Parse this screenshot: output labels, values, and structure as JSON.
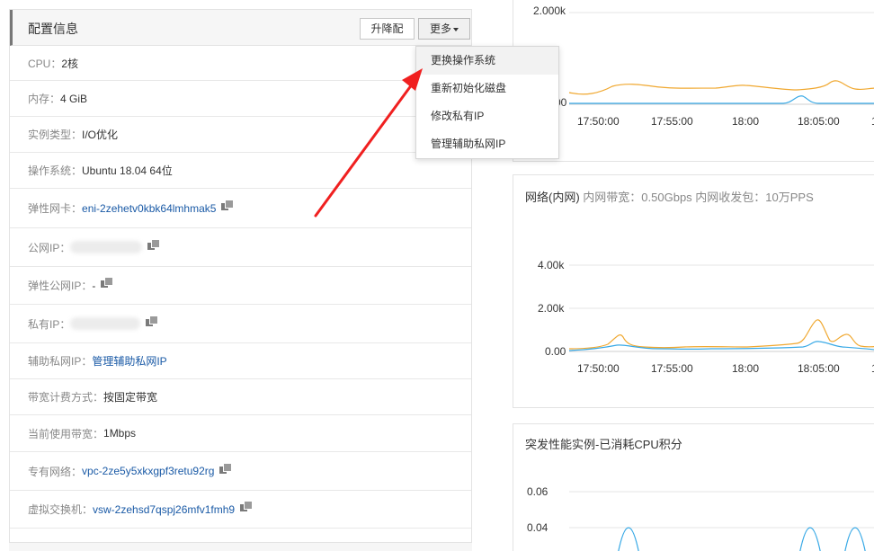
{
  "config": {
    "title": "配置信息",
    "upgrade_label": "升降配",
    "more_label": "更多",
    "rows": {
      "cpu_label": "CPU：",
      "cpu_value": "2核",
      "mem_label": "内存：",
      "mem_value": "4 GiB",
      "instance_type_label": "实例类型：",
      "instance_type_value": "I/O优化",
      "os_label": "操作系统：",
      "os_value": "Ubuntu 18.04 64位",
      "eni_label": "弹性网卡：",
      "eni_value": "eni-2zehetv0kbk64lmhmak5",
      "public_ip_label": "公网IP：",
      "eip_label": "弹性公网IP：",
      "eip_value": "-",
      "private_ip_label": "私有IP：",
      "secondary_ip_label": "辅助私网IP：",
      "secondary_ip_value": "管理辅助私网IP",
      "billing_label": "带宽计费方式：",
      "billing_value": "按固定带宽",
      "bandwidth_label": "当前使用带宽：",
      "bandwidth_value": "1Mbps",
      "vpc_label": "专有网络：",
      "vpc_value": "vpc-2ze5y5xkxgpf3retu92rg",
      "vswitch_label": "虚拟交换机：",
      "vswitch_value": "vsw-2zehsd7qspj26mfv1fmh9"
    }
  },
  "dropdown": {
    "items": [
      "更换操作系统",
      "重新初始化磁盘",
      "修改私有IP",
      "管理辅助私网IP"
    ]
  },
  "charts": {
    "top": {
      "yticks": [
        "2.000k",
        "0.00"
      ],
      "xticks": [
        "17:50:00",
        "17:55:00",
        "18:00",
        "18:05:00",
        "1"
      ]
    },
    "network": {
      "title": "网络(内网)",
      "subtitle": "内网带宽：0.50Gbps 内网收发包：10万PPS",
      "yticks": [
        "4.00k",
        "2.00k",
        "0.00"
      ],
      "xticks": [
        "17:50:00",
        "17:55:00",
        "18:00",
        "18:05:00",
        "1"
      ]
    },
    "burst": {
      "title": "突发性能实例-已消耗CPU积分",
      "yticks": [
        "0.06",
        "0.04"
      ]
    }
  },
  "colors": {
    "series_orange": "#f0a830",
    "series_blue": "#38a9e6",
    "link": "#1a5aa6",
    "arrow": "#f02020"
  },
  "chart_data": [
    {
      "type": "line",
      "title": "",
      "x": [
        "17:50:00",
        "17:55:00",
        "18:00",
        "18:05:00"
      ],
      "ylim": [
        0,
        2000
      ],
      "series": []
    },
    {
      "type": "line",
      "title": "网络(内网)",
      "x": [
        "17:50:00",
        "17:55:00",
        "18:00",
        "18:05:00"
      ],
      "ylim": [
        0,
        4000
      ],
      "series": []
    },
    {
      "type": "line",
      "title": "突发性能实例-已消耗CPU积分",
      "yticks": [
        0.04,
        0.06
      ],
      "series": []
    }
  ]
}
